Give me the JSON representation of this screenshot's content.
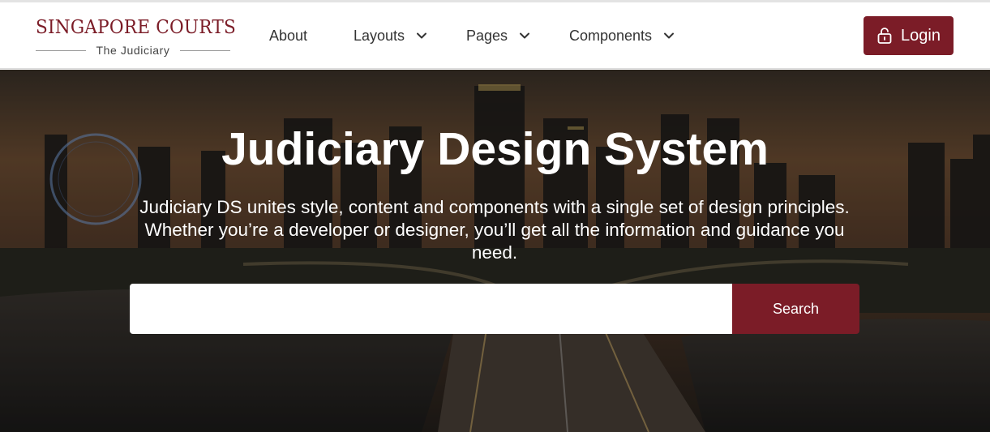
{
  "brand": {
    "title": "SINGAPORE COURTS",
    "subtitle": "The Judiciary"
  },
  "nav": {
    "items": [
      {
        "label": "About",
        "has_dropdown": false
      },
      {
        "label": "Layouts",
        "has_dropdown": true,
        "icon": "chevron-down-icon"
      },
      {
        "label": "Pages",
        "has_dropdown": true,
        "icon": "chevron-down-icon"
      },
      {
        "label": "Components",
        "has_dropdown": true,
        "icon": "chevron-down-icon"
      }
    ],
    "login_label": "Login",
    "login_icon": "lock-icon"
  },
  "hero": {
    "title": "Judiciary Design System",
    "description": "Judiciary DS unites style, content and components with a single set of design principles. Whether you’re a developer or designer, you’ll get all the information and guidance you need.",
    "background": "singapore-skyline-photo"
  },
  "search": {
    "value": "",
    "placeholder": "",
    "button_label": "Search"
  },
  "colors": {
    "brand": "#7b1c27",
    "nav_text": "#333333",
    "hero_text": "#ffffff"
  }
}
